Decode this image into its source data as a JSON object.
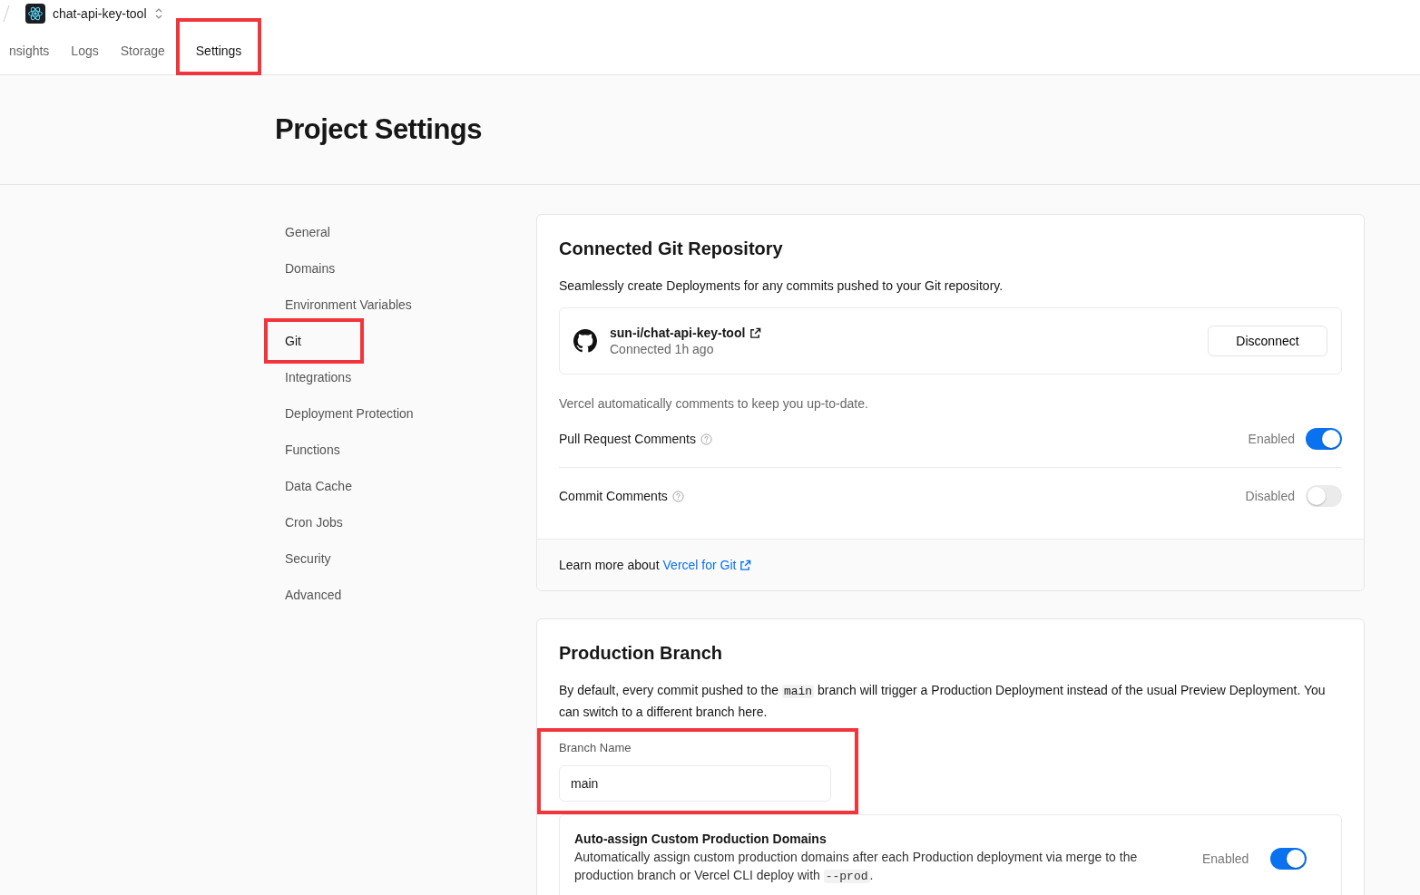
{
  "project": {
    "name": "chat-api-key-tool"
  },
  "tabs": [
    {
      "label": "nsights",
      "selected": false,
      "highlighted": false
    },
    {
      "label": "Logs",
      "selected": false,
      "highlighted": false
    },
    {
      "label": "Storage",
      "selected": false,
      "highlighted": false
    },
    {
      "label": "Settings",
      "selected": true,
      "highlighted": true
    }
  ],
  "page_title": "Project Settings",
  "sidebar": {
    "items": [
      {
        "label": "General",
        "selected": false,
        "highlighted": false
      },
      {
        "label": "Domains",
        "selected": false,
        "highlighted": false
      },
      {
        "label": "Environment Variables",
        "selected": false,
        "highlighted": false
      },
      {
        "label": "Git",
        "selected": true,
        "highlighted": true
      },
      {
        "label": "Integrations",
        "selected": false,
        "highlighted": false
      },
      {
        "label": "Deployment Protection",
        "selected": false,
        "highlighted": false
      },
      {
        "label": "Functions",
        "selected": false,
        "highlighted": false
      },
      {
        "label": "Data Cache",
        "selected": false,
        "highlighted": false
      },
      {
        "label": "Cron Jobs",
        "selected": false,
        "highlighted": false
      },
      {
        "label": "Security",
        "selected": false,
        "highlighted": false
      },
      {
        "label": "Advanced",
        "selected": false,
        "highlighted": false
      }
    ]
  },
  "git_card": {
    "title": "Connected Git Repository",
    "description": "Seamlessly create Deployments for any commits pushed to your Git repository.",
    "repo": {
      "name": "sun-i/chat-api-key-tool",
      "status": "Connected 1h ago",
      "button": "Disconnect"
    },
    "comments_note": "Vercel automatically comments to keep you up-to-date.",
    "settings": [
      {
        "label": "Pull Request Comments",
        "state_label": "Enabled",
        "on": true
      },
      {
        "label": "Commit Comments",
        "state_label": "Disabled",
        "on": false
      }
    ],
    "footer": {
      "text": "Learn more about",
      "link": "Vercel for Git"
    }
  },
  "branch_card": {
    "title": "Production Branch",
    "description_parts": [
      "By default, every commit pushed to the",
      "main",
      "branch will trigger a Production Deployment instead of the usual Preview Deployment. You can switch to a different branch here."
    ],
    "field": {
      "label": "Branch Name",
      "value": "main",
      "highlighted": true
    },
    "auto_assign": {
      "title": "Auto-assign Custom Production Domains",
      "description_parts": [
        "Automatically assign custom production domains after each Production deployment via merge to the production branch or Vercel CLI deploy with",
        "--prod",
        "."
      ],
      "state_label": "Enabled",
      "on": true
    }
  }
}
